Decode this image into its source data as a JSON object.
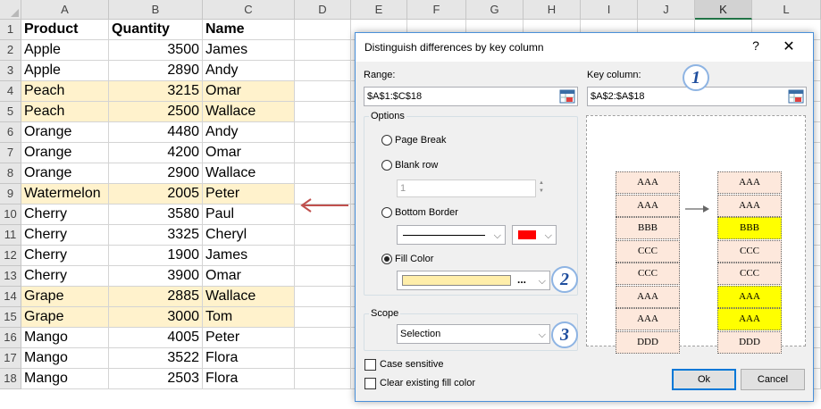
{
  "sheet": {
    "columns": [
      "A",
      "B",
      "C",
      "D",
      "E",
      "F",
      "G",
      "H",
      "I",
      "J",
      "K",
      "L"
    ],
    "selected_column": "K",
    "rows": [
      {
        "num": "1",
        "product": "Product",
        "quantity": "Quantity",
        "name": "Name",
        "header": true,
        "highlight": false
      },
      {
        "num": "2",
        "product": "Apple",
        "quantity": "3500",
        "name": "James",
        "highlight": false
      },
      {
        "num": "3",
        "product": "Apple",
        "quantity": "2890",
        "name": "Andy",
        "highlight": false
      },
      {
        "num": "4",
        "product": "Peach",
        "quantity": "3215",
        "name": "Omar",
        "highlight": true
      },
      {
        "num": "5",
        "product": "Peach",
        "quantity": "2500",
        "name": "Wallace",
        "highlight": true
      },
      {
        "num": "6",
        "product": "Orange",
        "quantity": "4480",
        "name": "Andy",
        "highlight": false
      },
      {
        "num": "7",
        "product": "Orange",
        "quantity": "4200",
        "name": "Omar",
        "highlight": false
      },
      {
        "num": "8",
        "product": "Orange",
        "quantity": "2900",
        "name": "Wallace",
        "highlight": false
      },
      {
        "num": "9",
        "product": "Watermelon",
        "quantity": "2005",
        "name": "Peter",
        "highlight": true
      },
      {
        "num": "10",
        "product": "Cherry",
        "quantity": "3580",
        "name": "Paul",
        "highlight": false
      },
      {
        "num": "11",
        "product": "Cherry",
        "quantity": "3325",
        "name": "Cheryl",
        "highlight": false
      },
      {
        "num": "12",
        "product": "Cherry",
        "quantity": "1900",
        "name": "James",
        "highlight": false
      },
      {
        "num": "13",
        "product": "Cherry",
        "quantity": "3900",
        "name": "Omar",
        "highlight": false
      },
      {
        "num": "14",
        "product": "Grape",
        "quantity": "2885",
        "name": "Wallace",
        "highlight": true
      },
      {
        "num": "15",
        "product": "Grape",
        "quantity": "3000",
        "name": "Tom",
        "highlight": true
      },
      {
        "num": "16",
        "product": "Mango",
        "quantity": "4005",
        "name": "Peter",
        "highlight": false
      },
      {
        "num": "17",
        "product": "Mango",
        "quantity": "3522",
        "name": "Flora",
        "highlight": false
      },
      {
        "num": "18",
        "product": "Mango",
        "quantity": "2503",
        "name": "Flora",
        "highlight": false
      }
    ],
    "highlight_color": "#fff2cc",
    "arrow_color": "#c0504d"
  },
  "dialog": {
    "title": "Distinguish differences by key column",
    "help_label": "?",
    "close_label": "✕",
    "range_label": "Range:",
    "range_value": "$A$1:$C$18",
    "key_column_label": "Key column:",
    "key_column_value": "$A$2:$A$18",
    "options_label": "Options",
    "page_break_label": "Page Break",
    "blank_row_label": "Blank row",
    "blank_row_value": "1",
    "bottom_border_label": "Bottom Border",
    "fill_color_label": "Fill Color",
    "fill_color_more": "...",
    "selected_option": "fill_color",
    "border_color": "#ff0000",
    "fill_color": "#ffeeaa",
    "scope_label": "Scope",
    "scope_value": "Selection",
    "case_sensitive_label": "Case sensitive",
    "clear_fill_label": "Clear existing fill color",
    "ok_label": "Ok",
    "cancel_label": "Cancel",
    "badges": [
      "1",
      "2",
      "3"
    ]
  },
  "preview": {
    "left_column": [
      "AAA",
      "AAA",
      "BBB",
      "CCC",
      "CCC",
      "AAA",
      "AAA",
      "DDD"
    ],
    "right_column": [
      "AAA",
      "AAA",
      "BBB",
      "CCC",
      "CCC",
      "AAA",
      "AAA",
      "DDD"
    ],
    "right_highlighted": [
      false,
      false,
      true,
      false,
      false,
      true,
      true,
      false
    ],
    "cell_color": "#fde8dc",
    "highlight_color": "#ffff00"
  }
}
